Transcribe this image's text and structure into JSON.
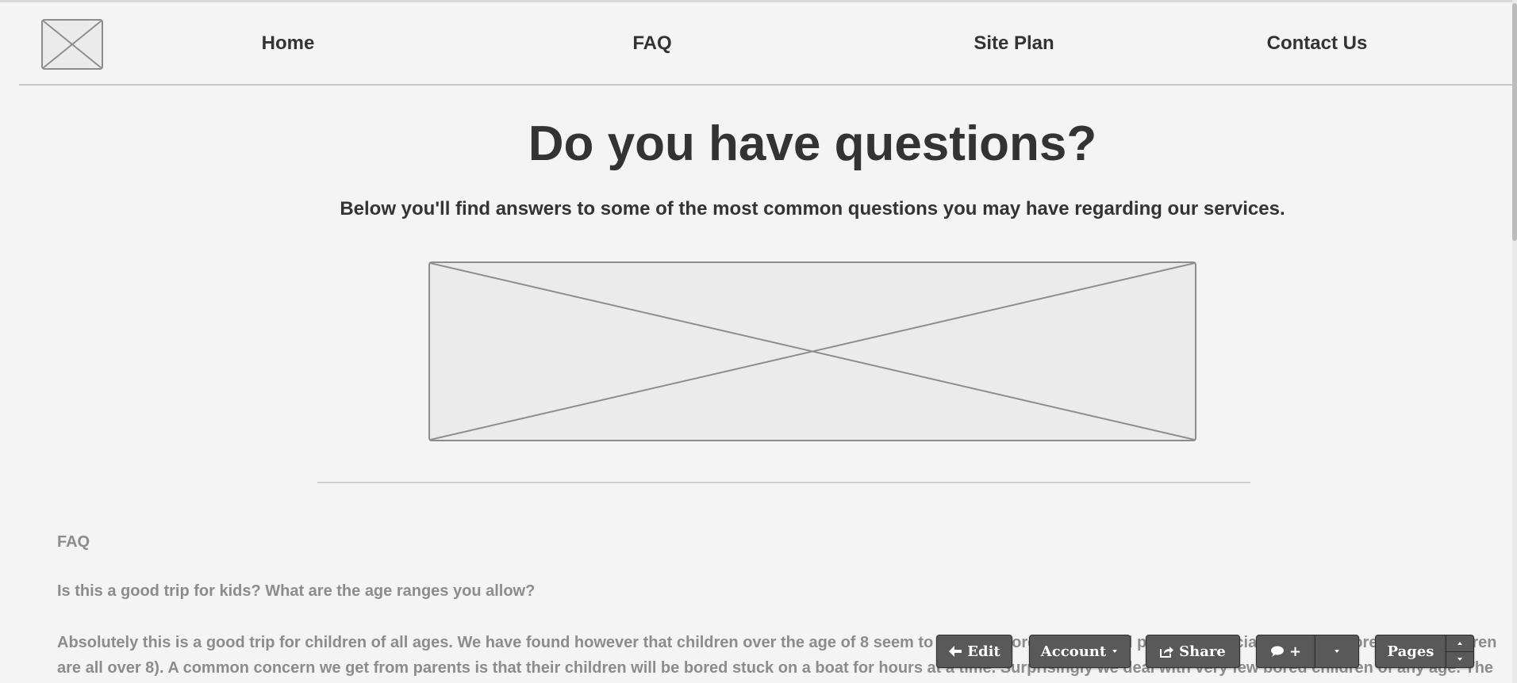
{
  "nav": {
    "home": "Home",
    "faq": "FAQ",
    "site_plan": "Site Plan",
    "contact": "Contact Us"
  },
  "hero": {
    "title": "Do you have questions?",
    "subtitle": "Below you'll find answers to some of the most common questions you may have regarding our services."
  },
  "faq": {
    "heading": "FAQ",
    "question": "Is this a good trip for kids? What are the age ranges you allow?",
    "answer": "Absolutely this is a good trip for children of all ages. We have found however that children over the age of 8 seem to enjoy it more overall (And parents especially enjoy it more if their children are all over 8). A common concern we get from parents is that their children will be bored stuck on a boat for hours at a time. Surprisingly we deal with very few bored children of any age. The areas we are rafting"
  },
  "toolbar": {
    "edit": "Edit",
    "account": "Account",
    "share": "Share",
    "comment_plus": "+",
    "pages": "Pages"
  },
  "icons": {
    "logo": "image-placeholder-icon",
    "hero": "image-placeholder-icon",
    "edit": "arrow-left-icon",
    "share": "share-icon",
    "comment": "speech-bubble-icon",
    "dropdown": "caret-down-icon",
    "stepper_up": "caret-up-icon",
    "stepper_down": "caret-down-icon"
  },
  "colors": {
    "background": "#f4f4f4",
    "text": "#333333",
    "muted_text": "#8c8c8c",
    "placeholder_fill": "#ebebeb",
    "placeholder_stroke": "#8c8c8c",
    "toolbar_button": "#595959"
  }
}
